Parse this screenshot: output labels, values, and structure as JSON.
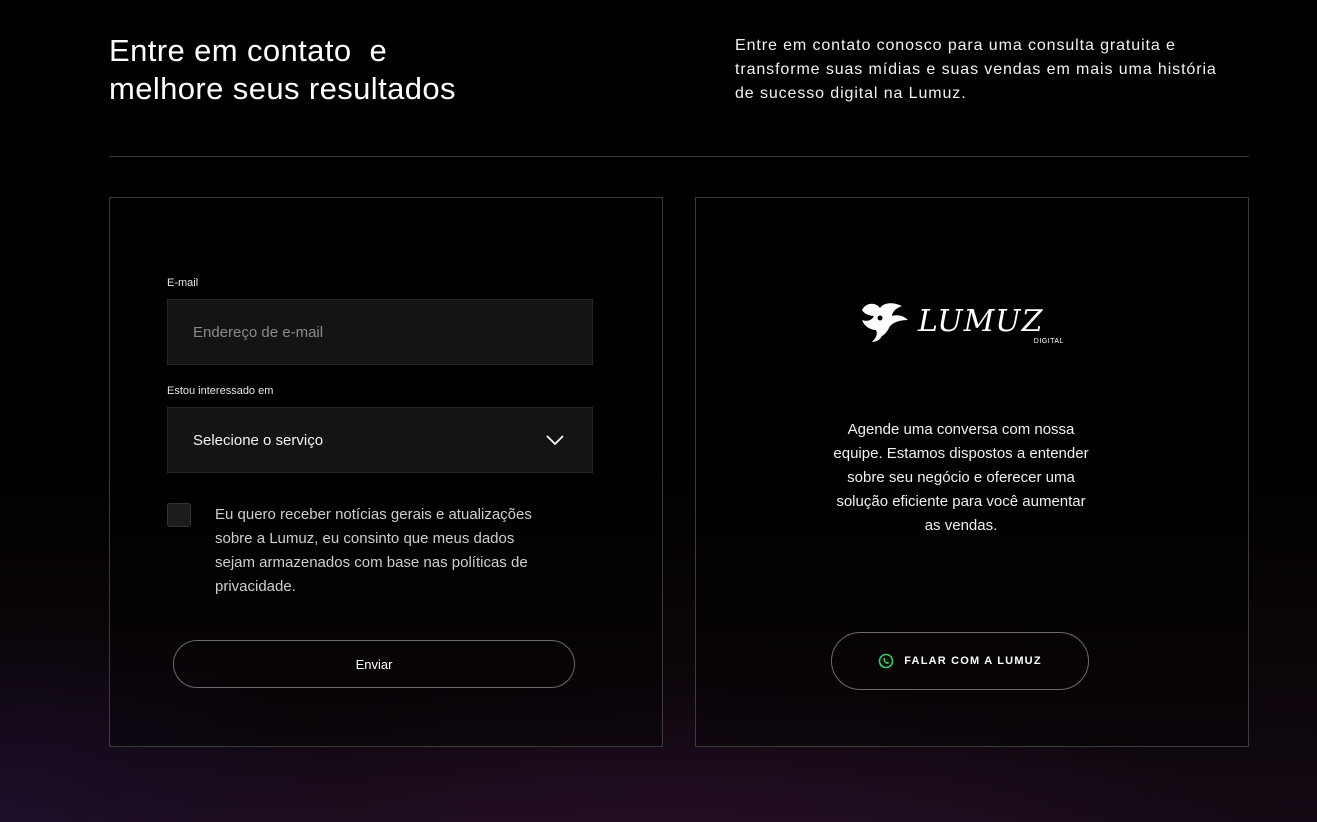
{
  "header": {
    "headline_line1": "Entre em contato  e",
    "headline_line2": "melhore seus resultados",
    "intro": "Entre em contato conosco para uma consulta gratuita e transforme suas mídias e suas vendas em mais uma história de sucesso digital na Lumuz."
  },
  "form": {
    "email_label": "E-mail",
    "email_placeholder": "Endereço de e-mail",
    "email_value": "",
    "service_label": "Estou interessado em",
    "service_selected": "Selecione o serviço",
    "consent_text": "Eu quero receber notícias gerais e atualizações sobre a Lumuz, eu consinto que meus dados sejam armazenados com base nas políticas de privacidade.",
    "consent_checked": false,
    "submit_label": "Enviar"
  },
  "info": {
    "logo_text": "LUMUZ",
    "logo_subtext": "DIGITAL",
    "description": "Agende uma conversa com nossa equipe. Estamos dispostos a entender sobre seu negócio e oferecer uma solução eficiente para você aumentar as vendas.",
    "cta_label": "FALAR COM A LUMUZ",
    "cta_icon": "whatsapp-icon"
  },
  "colors": {
    "background": "#000000",
    "card_border": "#3b3b3b",
    "input_bg": "#141414",
    "whatsapp_green": "#25D366"
  }
}
